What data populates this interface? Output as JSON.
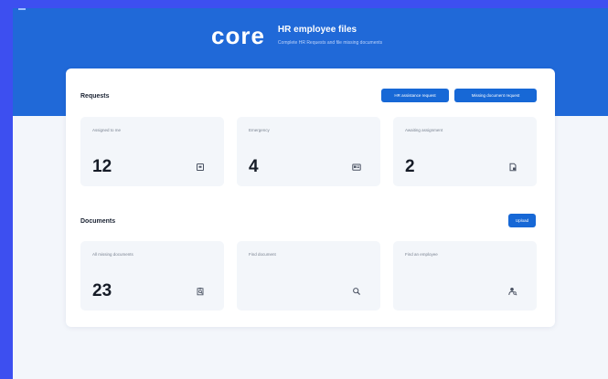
{
  "header": {
    "logo": "core",
    "title": "HR employee files",
    "subtitle": "Complete HR Requests and file missing documents"
  },
  "requests": {
    "title": "Requests",
    "buttons": [
      {
        "label": "HR assistance request"
      },
      {
        "label": "Missing document request"
      }
    ],
    "cards": [
      {
        "label": "Assigned to me",
        "value": "12",
        "icon": "id-card-icon"
      },
      {
        "label": "Emergency",
        "value": "4",
        "icon": "contact-card-icon"
      },
      {
        "label": "Awaiting assignment",
        "value": "2",
        "icon": "document-icon"
      }
    ]
  },
  "documents": {
    "title": "Documents",
    "upload_label": "Upload",
    "cards": [
      {
        "label": "All missing documents",
        "value": "23",
        "icon": "clipboard-search-icon"
      },
      {
        "label": "Find document",
        "value": "",
        "icon": "search-icon"
      },
      {
        "label": "Find an employee",
        "value": "",
        "icon": "person-search-icon"
      }
    ]
  },
  "colors": {
    "background": "#3d4ff0",
    "header": "#2069d8",
    "accent": "#1768d6",
    "card": "#f3f6fa",
    "page": "#f3f6fb"
  }
}
